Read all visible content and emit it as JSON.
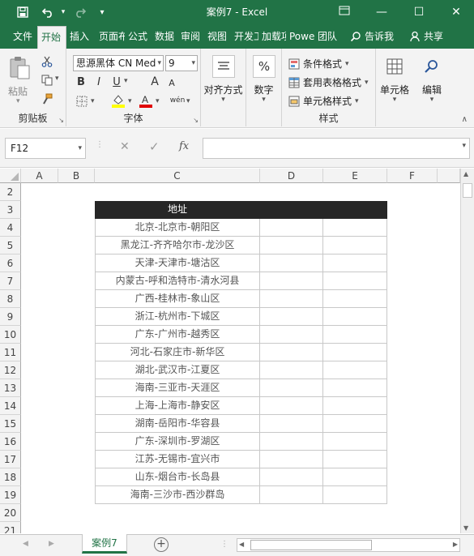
{
  "window": {
    "title": "案例7  -  Excel",
    "minimize": "—",
    "restore": "☐",
    "close": "✕"
  },
  "qat": {
    "save": "💾",
    "undo": "↶",
    "redo": "↷",
    "customize": "▾"
  },
  "tabs": [
    "文件",
    "开始",
    "插入",
    "页面布",
    "公式",
    "数据",
    "审阅",
    "视图",
    "开发工",
    "加载项",
    "Powe",
    "团队"
  ],
  "tell_me": "告诉我",
  "share": "共享",
  "ribbon": {
    "clipboard": {
      "paste": "粘贴",
      "label": "剪贴板"
    },
    "font": {
      "name": "思源黑体 CN Med",
      "size": "9",
      "label": "字体",
      "bold": "B",
      "italic": "I",
      "underline": "U",
      "grow": "A",
      "shrink": "A",
      "phonetic": "wén"
    },
    "alignment": {
      "label": "对齐方式"
    },
    "number": {
      "label": "数字",
      "symbol": "%"
    },
    "styles": {
      "conditional": "条件格式",
      "table": "套用表格格式",
      "cell": "单元格样式",
      "label": "样式"
    },
    "cells": {
      "label": "单元格"
    },
    "editing": {
      "label": "编辑"
    }
  },
  "formula_bar": {
    "name_box": "F12",
    "fx": "fx",
    "cancel": "✕",
    "enter": "✓",
    "value": ""
  },
  "columns": [
    "A",
    "B",
    "C",
    "D",
    "E",
    "F"
  ],
  "rows": [
    "2",
    "3",
    "4",
    "5",
    "6",
    "7",
    "8",
    "9",
    "10",
    "11",
    "12",
    "13",
    "14",
    "15",
    "16",
    "17",
    "18",
    "19",
    "20",
    "21"
  ],
  "table": {
    "header": "地址",
    "addresses": [
      "北京-北京市-朝阳区",
      "黑龙江-齐齐哈尔市-龙沙区",
      "天津-天津市-塘沽区",
      "内蒙古-呼和浩特市-清水河县",
      "广西-桂林市-象山区",
      "浙江-杭州市-下城区",
      "广东-广州市-越秀区",
      "河北-石家庄市-新华区",
      "湖北-武汉市-江夏区",
      "海南-三亚市-天涯区",
      "上海-上海市-静安区",
      "湖南-岳阳市-华容县",
      "广东-深圳市-罗湖区",
      "江苏-无锡市-宜兴市",
      "山东-烟台市-长岛县",
      "海南-三沙市-西沙群岛"
    ]
  },
  "sheet": {
    "tab": "案例7",
    "add": "+"
  },
  "colors": {
    "brand": "#217346",
    "table_header": "#262626"
  }
}
